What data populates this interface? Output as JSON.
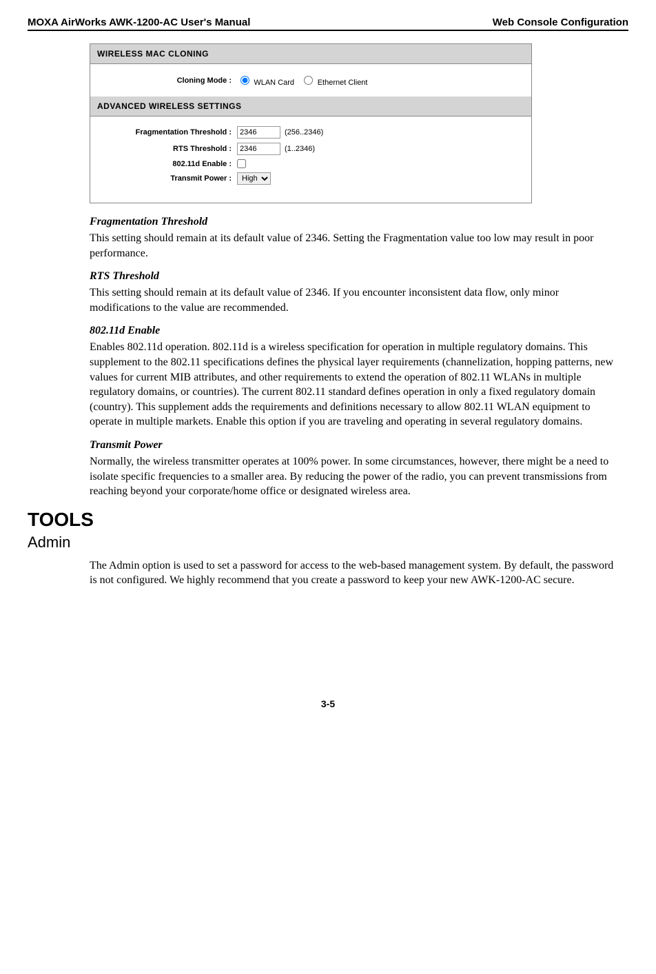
{
  "header": {
    "left": "MOXA AirWorks AWK-1200-AC User's Manual",
    "right": "Web Console Configuration"
  },
  "screenshot": {
    "section1_title": "WIRELESS MAC CLONING",
    "cloning_mode_label": "Cloning Mode :",
    "cloning_opt1": "WLAN Card",
    "cloning_opt2": "Ethernet Client",
    "section2_title": "ADVANCED WIRELESS SETTINGS",
    "frag_label": "Fragmentation Threshold :",
    "frag_value": "2346",
    "frag_range": "(256..2346)",
    "rts_label": "RTS Threshold :",
    "rts_value": "2346",
    "rts_range": "(1..2346)",
    "d_label": "802.11d Enable :",
    "tx_label": "Transmit Power :",
    "tx_value": "High"
  },
  "sections": {
    "frag": {
      "title": "Fragmentation Threshold",
      "body": "This setting should remain at its default value of 2346. Setting the Fragmentation value too low may result in poor performance."
    },
    "rts": {
      "title": "RTS Threshold",
      "body": "This setting should remain at its default value of 2346. If you encounter inconsistent data flow, only minor modifications to the value are recommended."
    },
    "d": {
      "title": "802.11d Enable",
      "body": "Enables 802.11d operation. 802.11d is a wireless specification for operation in multiple regulatory domains. This supplement to the 802.11 specifications defines the physical layer requirements (channelization, hopping patterns, new values for current MIB attributes, and other requirements to extend the operation of 802.11 WLANs in multiple regulatory domains, or countries). The current 802.11 standard defines operation in only a fixed regulatory domain (country). This supplement adds the requirements and definitions necessary to allow 802.11 WLAN equipment to operate in multiple markets. Enable this option if you are traveling and operating in several regulatory domains."
    },
    "tx": {
      "title": "Transmit Power",
      "body": "Normally, the wireless transmitter operates at 100% power. In some circumstances, however, there might be a need to isolate specific frequencies to a smaller area. By reducing the power of the radio, you can prevent transmissions from reaching beyond your corporate/home office or designated wireless area."
    }
  },
  "tools_heading": "TOOLS",
  "admin_heading": "Admin",
  "admin_body": "The Admin option is used to set a password for access to the web-based management system. By default, the password is not configured. We highly recommend that you create a password to keep your new AWK-1200-AC secure.",
  "page_number": "3-5"
}
